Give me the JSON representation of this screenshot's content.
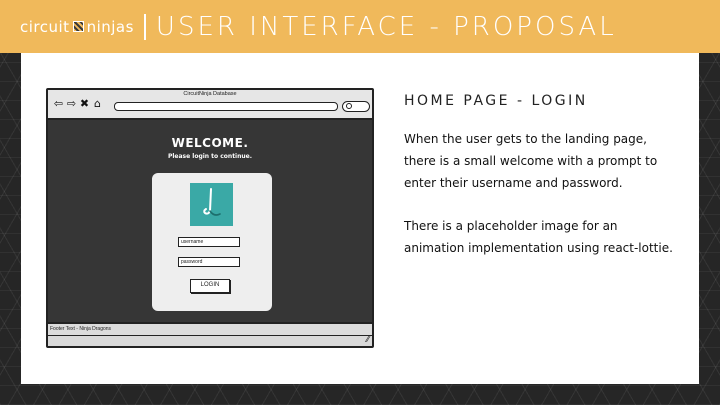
{
  "header": {
    "brand_left": "circuit",
    "brand_right": "ninjas",
    "title": "USER INTERFACE - PROPOSAL",
    "color": "#f0b95b"
  },
  "mockup": {
    "window_title": "CircuitNinja Database",
    "nav_icons": [
      "back-arrow-icon",
      "forward-arrow-icon",
      "close-x-icon",
      "home-icon"
    ],
    "welcome_title": "WELCOME.",
    "welcome_subtitle": "Please login to continue.",
    "username_placeholder": "username",
    "password_placeholder": "password",
    "login_label": "LOGIN",
    "footer_text": "Footer Text - Ninja Dragons",
    "placeholder_color": "#3aa9a6"
  },
  "content": {
    "heading": "HOME PAGE - LOGIN",
    "paragraph_1": "When the user gets to the landing page, there is a small welcome with a prompt to enter their username and password.",
    "paragraph_2": "There is a placeholder image for an animation implementation using react-lottie."
  }
}
